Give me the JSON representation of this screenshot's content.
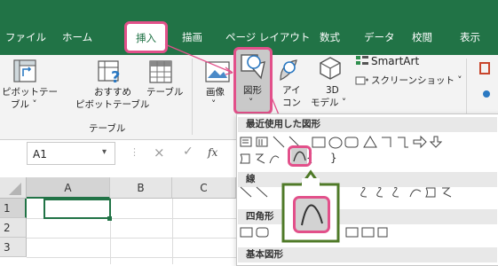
{
  "menu": {
    "tabs": [
      {
        "label": "ファイル"
      },
      {
        "label": "ホーム"
      },
      {
        "label": "挿入"
      },
      {
        "label": "描画"
      },
      {
        "label": "ページ レイアウト"
      },
      {
        "label": "数式"
      },
      {
        "label": "データ"
      },
      {
        "label": "校閲"
      },
      {
        "label": "表示"
      }
    ],
    "active_tab": "挿入"
  },
  "ribbon": {
    "pivot_label_1": "ピボットテー",
    "pivot_label_2": "ブル ˅",
    "recommended_label_1": "おすすめ",
    "recommended_label_2": "ピボットテーブル",
    "table_label": "テーブル",
    "group_table_label": "テーブル",
    "image_label": "画像",
    "shapes_label": "図形",
    "shapes_arrow": "˅",
    "icons_label_1": "アイ",
    "icons_label_2": "コン",
    "model3d_label_1": "3D",
    "model3d_label_2": "モデル ˅",
    "smartart_label": "SmartArt",
    "screenshot_label": "スクリーンショット ˅"
  },
  "formula_bar": {
    "name_box": "A1",
    "name_box_arrow": "▾",
    "cancel_glyph": "×",
    "enter_glyph": "✓",
    "fx_glyph": "fx"
  },
  "grid": {
    "columns": [
      "A",
      "B",
      "C"
    ],
    "rows": [
      "1",
      "2",
      "3"
    ]
  },
  "shapes_menu": {
    "recent_header": "最近使用した図形",
    "lines_header": "線",
    "rect_header": "四角形",
    "basic_header": "基本図形",
    "brace_left": "{",
    "brace_right": "}"
  },
  "colors": {
    "excel_green": "#217346",
    "highlight_pink": "#e2508a",
    "callout_green": "#4f7a28"
  }
}
